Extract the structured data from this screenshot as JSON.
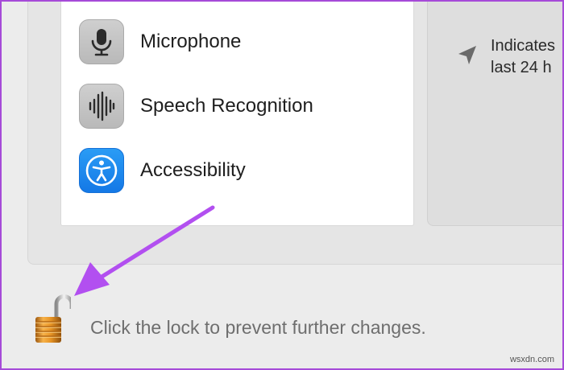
{
  "privacy_list": {
    "items": [
      {
        "label": "Microphone",
        "icon": "microphone-icon"
      },
      {
        "label": "Speech Recognition",
        "icon": "speech-recognition-icon"
      },
      {
        "label": "Accessibility",
        "icon": "accessibility-icon"
      }
    ]
  },
  "info": {
    "icon": "location-arrow-icon",
    "text": "Indicates\nlast 24 h"
  },
  "lock": {
    "icon": "open-padlock-icon",
    "text": "Click the lock to prevent further changes."
  },
  "annotation": {
    "arrow_color": "#b24ff0"
  },
  "watermark": "wsxdn.com"
}
